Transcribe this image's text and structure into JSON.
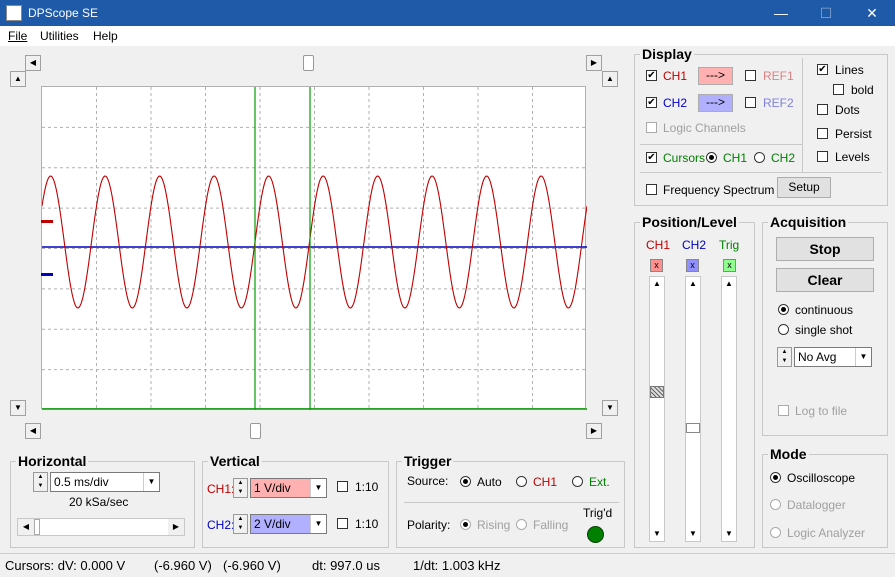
{
  "window": {
    "title": "DPScope SE",
    "min": "—",
    "max": "☐",
    "close": "✕"
  },
  "menu": [
    "File",
    "Utilities",
    "Help"
  ],
  "display": {
    "title": "Display",
    "ch1": "CH1",
    "ch2": "CH2",
    "arrow": "--->",
    "ref1": "REF1",
    "ref2": "REF2",
    "logic": "Logic Channels",
    "cursors": "Cursors",
    "cur_ch1": "CH1",
    "cur_ch2": "CH2",
    "freq": "Frequency Spectrum",
    "setup": "Setup",
    "lines": "Lines",
    "bold": "bold",
    "dots": "Dots",
    "persist": "Persist",
    "levels": "Levels"
  },
  "position": {
    "title": "Position/Level",
    "ch1": "CH1",
    "ch2": "CH2",
    "trig": "Trig",
    "x": "x"
  },
  "acquisition": {
    "title": "Acquisition",
    "stop": "Stop",
    "clear": "Clear",
    "continuous": "continuous",
    "single": "single shot",
    "avg": "No Avg",
    "log": "Log to file"
  },
  "mode": {
    "title": "Mode",
    "osc": "Oscilloscope",
    "datalogger": "Datalogger",
    "logic": "Logic Analyzer"
  },
  "horizontal": {
    "title": "Horizontal",
    "timebase": "0.5 ms/div",
    "rate": "20 kSa/sec"
  },
  "vertical": {
    "title": "Vertical",
    "ch1_label": "CH1:",
    "ch1_value": "1 V/div",
    "ch2_label": "CH2:",
    "ch2_value": "2 V/div",
    "ratio": "1:10"
  },
  "trigger": {
    "title": "Trigger",
    "source": "Source:",
    "auto": "Auto",
    "ch1": "CH1",
    "ext": "Ext.",
    "polarity": "Polarity:",
    "rising": "Rising",
    "falling": "Falling",
    "trigd": "Trig'd"
  },
  "status": {
    "cursors": "Cursors: dV: 0.000 V",
    "v1": "(-6.960 V)",
    "v2": "(-6.960 V)",
    "dt": "dt: 997.0 us",
    "freq": "1/dt: 1.003 kHz"
  },
  "colors": {
    "ch1": "#c00000",
    "ch2": "#0000c0",
    "cursor": "#00a000",
    "trig_led": "#008000"
  }
}
